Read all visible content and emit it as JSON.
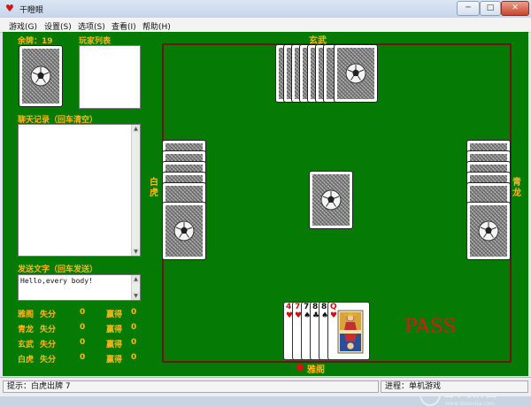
{
  "window": {
    "title": "干瞪眼",
    "app_icon": "heart-icon",
    "controls": {
      "minimize": "─",
      "maximize": "□",
      "close": "✕"
    }
  },
  "menu": [
    {
      "label": "游戏(G)"
    },
    {
      "label": "设置(S)"
    },
    {
      "label": "选项(S)"
    },
    {
      "label": "查看(I)"
    },
    {
      "label": "帮助(H)"
    }
  ],
  "left_panel": {
    "remaining_label": "余牌：19",
    "player_list_label": "玩家列表",
    "chat_label": "聊天记录（回车清空）",
    "send_label": "发送文字（回车发送）",
    "send_text": "Hello,every body!"
  },
  "scores": [
    {
      "name": "雅阁",
      "lose_label": "失分",
      "lose_value": "0",
      "win_label": "赢得",
      "win_value": "0"
    },
    {
      "name": "青龙",
      "lose_label": "失分",
      "lose_value": "0",
      "win_label": "赢得",
      "win_value": "0"
    },
    {
      "name": "玄武",
      "lose_label": "失分",
      "lose_value": "0",
      "win_label": "赢得",
      "win_value": "0"
    },
    {
      "name": "白虎",
      "lose_label": "失分",
      "lose_value": "0",
      "win_label": "赢得",
      "win_value": "0"
    }
  ],
  "players": {
    "top": {
      "name": "玄武"
    },
    "left": {
      "name": "白虎"
    },
    "right": {
      "name": "青龙"
    },
    "bottom": {
      "name": "雅阁"
    }
  },
  "hand": [
    {
      "rank": "4",
      "suit": "♥",
      "color": "#d01010"
    },
    {
      "rank": "7",
      "suit": "♥",
      "color": "#d01010"
    },
    {
      "rank": "7",
      "suit": "♠",
      "color": "#111111"
    },
    {
      "rank": "8",
      "suit": "♣",
      "color": "#111111"
    },
    {
      "rank": "8",
      "suit": "♠",
      "color": "#111111"
    },
    {
      "rank": "Q",
      "suit": "♥",
      "color": "#d01010"
    }
  ],
  "pass_text": "PASS",
  "status": {
    "hint": "提示：白虎出牌 7",
    "mode": "进程：单机游戏"
  },
  "watermark": {
    "text": "当下软件园",
    "url": "www.downxia.com"
  },
  "colors": {
    "table": "#057a05",
    "label": "#ffb61a",
    "border": "#6b1515",
    "pass": "#d41a1a"
  }
}
